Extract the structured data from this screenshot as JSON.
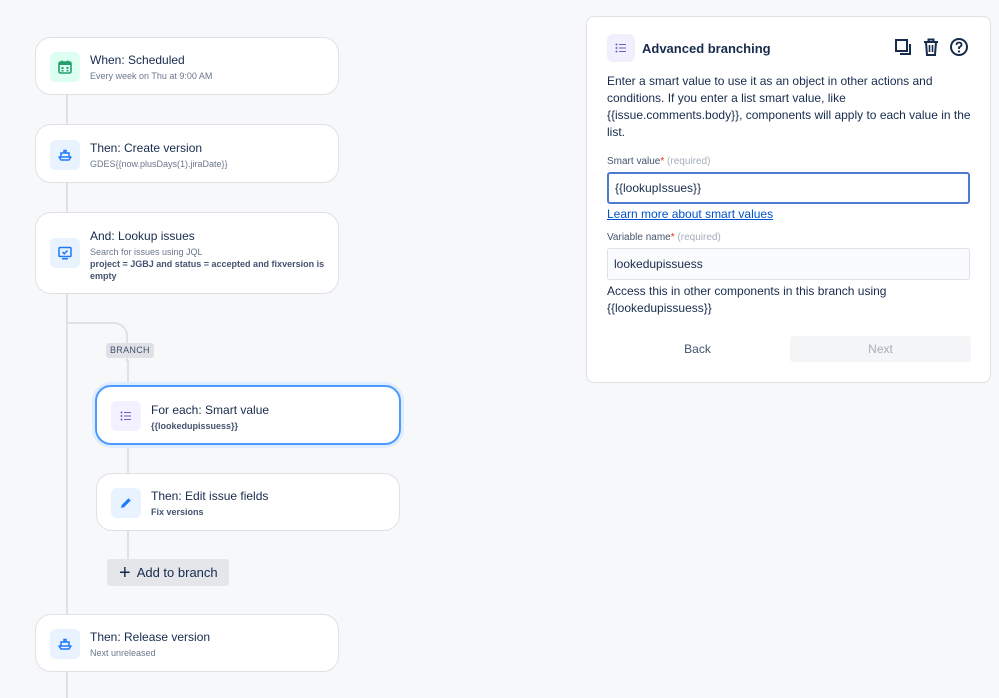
{
  "flow": {
    "trigger": {
      "title": "When: Scheduled",
      "subtitle": "Every week on Thu at 9:00 AM"
    },
    "create_version": {
      "title": "Then: Create version",
      "subtitle": "GDES{{now.plusDays(1).jiraDate}}"
    },
    "lookup": {
      "title": "And: Lookup issues",
      "subtitle": "Search for issues using JQL",
      "detail": "project = JGBJ and status = accepted and fixversion is empty"
    },
    "branch_label": "BRANCH",
    "for_each": {
      "title": "For each: Smart value",
      "subtitle": "{{lookedupissuess}}"
    },
    "edit_fields": {
      "title": "Then: Edit issue fields",
      "subtitle": "Fix versions"
    },
    "add_to_branch": "Add to branch",
    "release": {
      "title": "Then: Release version",
      "subtitle": "Next unreleased"
    }
  },
  "panel": {
    "title": "Advanced branching",
    "description": "Enter a smart value to use it as an object in other actions and conditions. If you enter a list smart value, like {{issue.comments.body}}, components will apply to each value in the list.",
    "smart_value_label": "Smart value",
    "required_mark": "*",
    "required_text": "(required)",
    "smart_value": "{{lookupIssues}}",
    "learn_more": "Learn more about smart values",
    "variable_label": "Variable name",
    "variable_value": "lookedupissuess",
    "help": "Access this in other components in this branch using {{lookedupissuess}}",
    "back": "Back",
    "next": "Next"
  },
  "colors": {
    "accent": "#0052cc",
    "trigger_tile": "#dcfff1",
    "action_tile": "#e9f2ff",
    "branch_tile": "#f3f0ff"
  }
}
